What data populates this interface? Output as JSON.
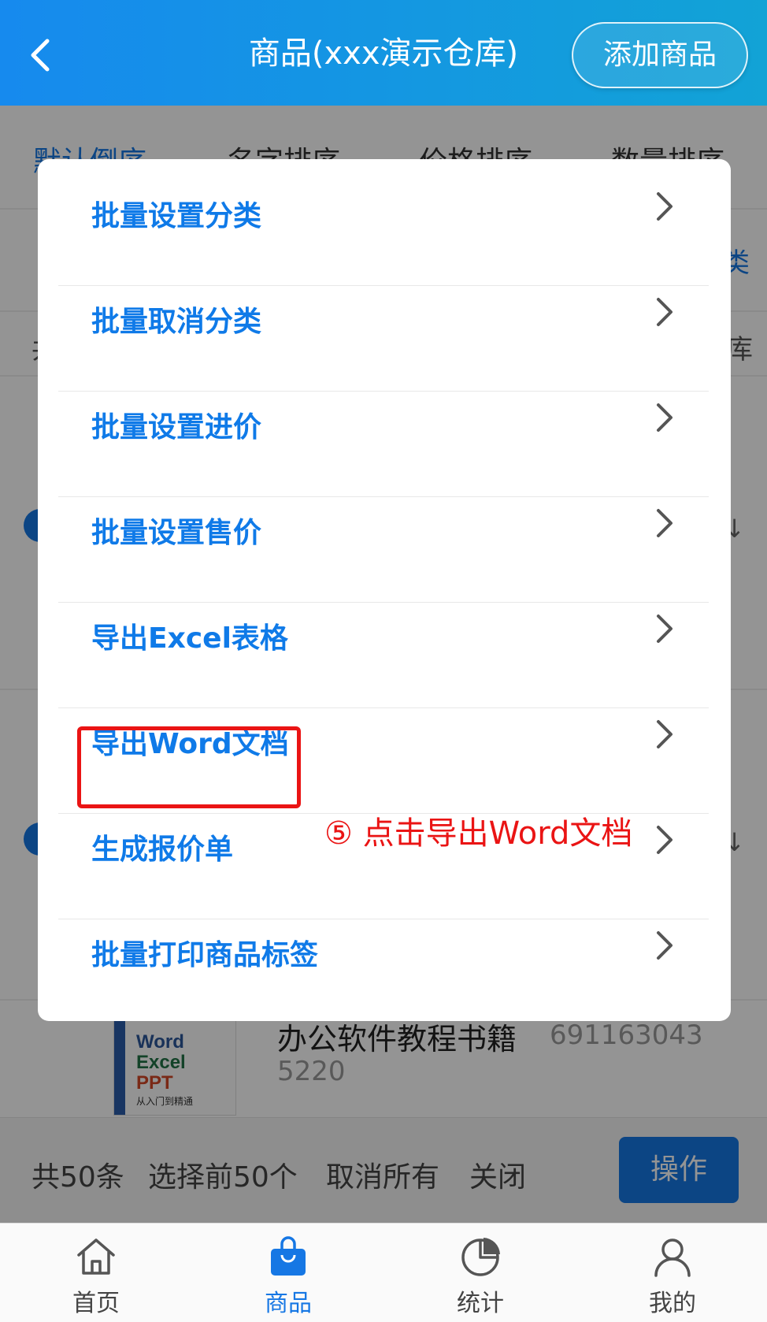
{
  "header": {
    "title": "商品(xxx演示仓库)",
    "add_button": "添加商品"
  },
  "sort_bar": {
    "items": [
      "默认倒序",
      "名字排序",
      "价格排序",
      "数量排序"
    ],
    "active_index": 0
  },
  "background": {
    "side_fragments": [
      "共",
      "库",
      "类"
    ],
    "product": {
      "name": "办公软件教程书籍",
      "code_line1": "691163043",
      "code_line2": "5220",
      "cover": {
        "line1": "Word",
        "line2": "Excel",
        "line3": "PPT",
        "line4": "从入门到精通"
      }
    },
    "bottom_actions": {
      "total": "共50条",
      "select_first": "选择前50个",
      "cancel_all": "取消所有",
      "close": "关闭",
      "operate_button": "操作"
    }
  },
  "modal": {
    "items": [
      {
        "label": "批量设置分类"
      },
      {
        "label": "批量取消分类"
      },
      {
        "label": "批量设置进价"
      },
      {
        "label": "批量设置售价"
      },
      {
        "label": "导出Excel表格"
      },
      {
        "label": "导出Word文档"
      },
      {
        "label": "生成报价单"
      },
      {
        "label": "批量打印商品标签"
      }
    ],
    "highlighted_index": 5,
    "annotation": "⑤ 点击导出Word文档"
  },
  "tabbar": {
    "tabs": [
      {
        "label": "首页",
        "icon": "home-icon"
      },
      {
        "label": "商品",
        "icon": "shopping-bag-icon"
      },
      {
        "label": "统计",
        "icon": "pie-chart-icon"
      },
      {
        "label": "我的",
        "icon": "user-icon"
      }
    ],
    "active_index": 1
  },
  "colors": {
    "accent": "#1677e4",
    "menu_text": "#0f7ae8",
    "highlight": "#ea1414"
  }
}
